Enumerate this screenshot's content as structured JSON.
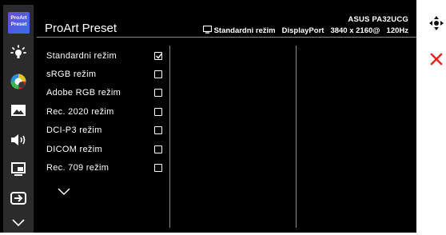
{
  "header": {
    "title": "ProArt Preset",
    "model": "ASUS PA32UCG",
    "mode": "Standardni režim",
    "input": "DisplayPort",
    "resolution": "3840 x 2160@",
    "refresh": "120Hz"
  },
  "rail": {
    "logo_line1": "ProArt",
    "logo_line2": "Preset",
    "items": [
      {
        "icon": "proart-preset-icon"
      },
      {
        "icon": "brightness-icon"
      },
      {
        "icon": "color-icon"
      },
      {
        "icon": "image-icon"
      },
      {
        "icon": "sound-icon"
      },
      {
        "icon": "pip-icon"
      },
      {
        "icon": "input-select-icon"
      },
      {
        "icon": "chevron-down-icon"
      }
    ]
  },
  "options": [
    {
      "label": "Standardni režim",
      "checked": true
    },
    {
      "label": "sRGB režim",
      "checked": false
    },
    {
      "label": "Adobe RGB režim",
      "checked": false
    },
    {
      "label": "Rec. 2020 režim",
      "checked": false
    },
    {
      "label": "DCI-P3 režim",
      "checked": false
    },
    {
      "label": "DICOM režim",
      "checked": false
    },
    {
      "label": "Rec. 709 režim",
      "checked": false
    }
  ],
  "nav": {
    "icon": "joystick-icon",
    "exit_icon": "close-icon"
  },
  "colors": {
    "accent_red": "#e8211b",
    "logo_purple": "#6a4bd8",
    "background": "#000000",
    "rail": "#2b2b2b"
  }
}
